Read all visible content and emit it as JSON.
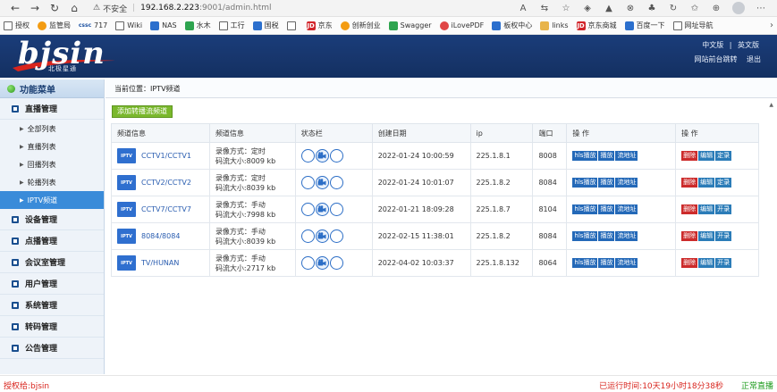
{
  "browser": {
    "warning": "⚠",
    "not_secure": "不安全",
    "host": "192.168.2.223",
    "path": ":9001/admin.html",
    "bookmarks": [
      {
        "label": "授权",
        "icon": "doc"
      },
      {
        "label": "监管局",
        "icon": "orange"
      },
      {
        "label": "717",
        "icon": "cssc"
      },
      {
        "label": "Wiki",
        "icon": "doc"
      },
      {
        "label": "NAS",
        "icon": "blue"
      },
      {
        "label": "水木",
        "icon": "green"
      },
      {
        "label": "工行",
        "icon": "doc"
      },
      {
        "label": "国税",
        "icon": "blue"
      },
      {
        "label": "",
        "icon": "doc"
      },
      {
        "label": "京东",
        "icon": "jd"
      },
      {
        "label": "创新创业",
        "icon": "orange"
      },
      {
        "label": "Swagger",
        "icon": "green"
      },
      {
        "label": "iLovePDF",
        "icon": "red"
      },
      {
        "label": "板权中心",
        "icon": "blue"
      },
      {
        "label": "links",
        "icon": "folder"
      },
      {
        "label": "京东商城",
        "icon": "jd"
      },
      {
        "label": "百度一下",
        "icon": "blue"
      },
      {
        "label": "网址导航",
        "icon": "doc"
      }
    ]
  },
  "header": {
    "logo_text": "bjsin",
    "logo_sub": "北极星通",
    "lang_cn": "中文版",
    "lang_sep": "|",
    "lang_en": "英文版",
    "link_front": "网站前台跳转",
    "link_logout": "退出"
  },
  "sidebar": {
    "title": "功能菜单",
    "groups": [
      {
        "label": "直播管理",
        "children": [
          {
            "label": "全部列表",
            "active": false
          },
          {
            "label": "直播列表",
            "active": false
          },
          {
            "label": "回播列表",
            "active": false
          },
          {
            "label": "轮播列表",
            "active": false
          },
          {
            "label": "IPTV频道",
            "active": true
          }
        ]
      },
      {
        "label": "设备管理"
      },
      {
        "label": "点播管理"
      },
      {
        "label": "会议室管理"
      },
      {
        "label": "用户管理"
      },
      {
        "label": "系统管理"
      },
      {
        "label": "转码管理"
      },
      {
        "label": "公告管理"
      }
    ]
  },
  "main": {
    "breadcrumb": "当前位置：IPTV频道",
    "add_button": "添加转播流频道",
    "columns": [
      "频道信息",
      "频道信息",
      "状态栏",
      "创建日期",
      "ip",
      "端口",
      "操 作",
      "操 作"
    ],
    "badge": "IPTV",
    "rows": [
      {
        "channel": "CCTV1/CCTV1",
        "mode": "录像方式：定时",
        "rate": "码流大小:8009 kb",
        "date": "2022-01-24 10:00:59",
        "ip": "225.1.8.1",
        "port": "8008",
        "ops1": [
          "hls播放",
          "播放",
          "流地址"
        ],
        "ops2": [
          "删除",
          "编辑",
          "定录"
        ]
      },
      {
        "channel": "CCTV2/CCTV2",
        "mode": "录像方式：定时",
        "rate": "码流大小:8039 kb",
        "date": "2022-01-24 10:01:07",
        "ip": "225.1.8.2",
        "port": "8084",
        "ops1": [
          "hls播放",
          "播放",
          "流地址"
        ],
        "ops2": [
          "删除",
          "编辑",
          "定录"
        ]
      },
      {
        "channel": "CCTV7/CCTV7",
        "mode": "录像方式：手动",
        "rate": "码流大小:7998 kb",
        "date": "2022-01-21 18:09:28",
        "ip": "225.1.8.7",
        "port": "8104",
        "ops1": [
          "hls播放",
          "播放",
          "流地址"
        ],
        "ops2": [
          "删除",
          "编辑",
          "开录"
        ]
      },
      {
        "channel": "8084/8084",
        "mode": "录像方式：手动",
        "rate": "码流大小:8039 kb",
        "date": "2022-02-15 11:38:01",
        "ip": "225.1.8.2",
        "port": "8084",
        "ops1": [
          "hls播放",
          "播放",
          "流地址"
        ],
        "ops2": [
          "删除",
          "编辑",
          "开录"
        ]
      },
      {
        "channel": "TV/HUNAN",
        "mode": "录像方式：手动",
        "rate": "码流大小:2717 kb",
        "date": "2022-04-02 10:03:37",
        "ip": "225.1.8.132",
        "port": "8064",
        "ops1": [
          "hls播放",
          "播放",
          "流地址"
        ],
        "ops2": [
          "删除",
          "编辑",
          "开录"
        ]
      }
    ]
  },
  "footer": {
    "license": "授权给:bjsin",
    "runtime": "已运行时间:10天19小时18分38秒",
    "status": "正常直播"
  },
  "colors": {
    "header_bg": "#17356b",
    "active_menu": "#3a8bd9",
    "add_button": "#7ab82c",
    "op_blue": "#2469b8",
    "op_red": "#cc2b2b",
    "footer_red": "#d8241d",
    "footer_green": "#1c9b1c"
  }
}
